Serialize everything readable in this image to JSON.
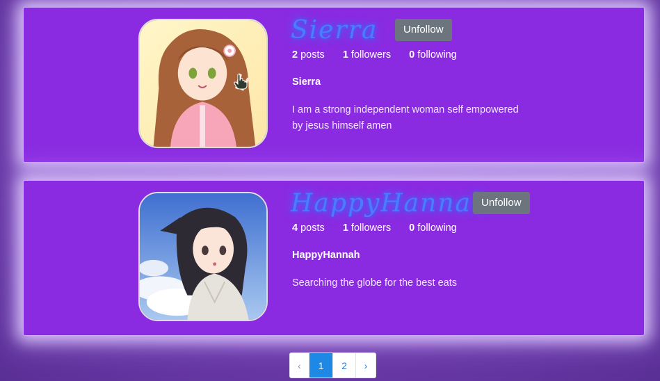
{
  "profiles": [
    {
      "username": "Sierra",
      "button_label": "Unfollow",
      "posts_count": "2",
      "posts_label": "posts",
      "followers_count": "1",
      "followers_label": "followers",
      "following_count": "0",
      "following_label": "following",
      "display_name": "Sierra",
      "bio": "I am a strong independent woman self empowered by jesus himself amen",
      "avatar_icon": "anime-girl-avatar"
    },
    {
      "username": "HappyHannah",
      "button_label": "Unfollow",
      "posts_count": "4",
      "posts_label": "posts",
      "followers_count": "1",
      "followers_label": "followers",
      "following_count": "0",
      "following_label": "following",
      "display_name": "HappyHannah",
      "bio": "Searching the globe for the best eats",
      "avatar_icon": "anime-girl-avatar"
    }
  ],
  "pagination": {
    "prev": "‹",
    "pages": [
      "1",
      "2"
    ],
    "next": "›",
    "current": "1"
  },
  "colors": {
    "card_bg": "#8a2be2",
    "username_glow": "#3b78ff",
    "button_bg": "#6c757d",
    "active_page": "#1e88e5"
  }
}
